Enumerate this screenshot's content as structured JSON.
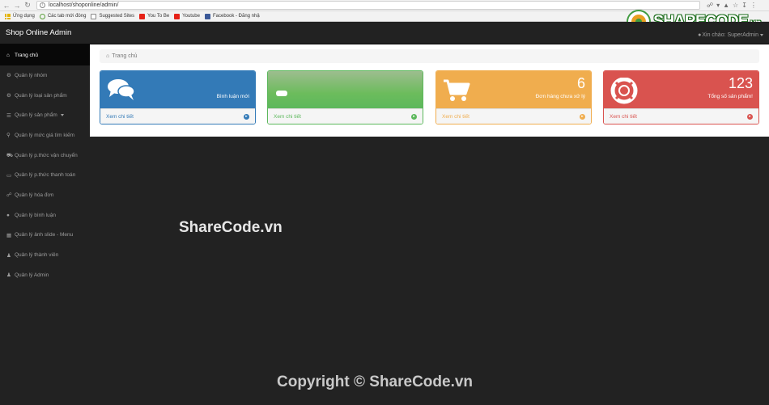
{
  "browser": {
    "url": "localhost/shoponline/admin/",
    "bookmarks": [
      {
        "label": "Ứng dụng",
        "icon": "apps-icon"
      },
      {
        "label": "Các tab mới đóng",
        "icon": "history-icon"
      },
      {
        "label": "Suggested Sites",
        "icon": "page-icon"
      },
      {
        "label": "You To Be",
        "icon": "youtube-icon"
      },
      {
        "label": "Youtube",
        "icon": "youtube-icon"
      },
      {
        "label": "Facebook - Đăng nhậ",
        "icon": "facebook-icon"
      }
    ]
  },
  "logo": {
    "text": "SHARECODE",
    "suffix": ".vn"
  },
  "navbar": {
    "brand": "Shop Online Admin",
    "user_greeting": "Xin chào: SuperAdmin"
  },
  "sidebar": {
    "items": [
      {
        "label": "Trang chủ",
        "icon": "home-icon",
        "active": true
      },
      {
        "label": "Quản lý nhóm",
        "icon": "gear-icon"
      },
      {
        "label": "Quản lý loại sản phẩm",
        "icon": "gears-icon"
      },
      {
        "label": "Quản lý sản phẩm",
        "icon": "list-icon",
        "has_caret": true
      },
      {
        "label": "Quản lý mức giá tìm kiếm",
        "icon": "search-icon"
      },
      {
        "label": "Quản lý p.thức vận chuyển",
        "icon": "truck-icon"
      },
      {
        "label": "Quản lý p.thức thanh toán",
        "icon": "credit-card-icon"
      },
      {
        "label": "Quản lý hóa đơn",
        "icon": "cart-icon"
      },
      {
        "label": "Quản lý bình luận",
        "icon": "comments-icon"
      },
      {
        "label": "Quản lý ảnh slide - Menu",
        "icon": "picture-icon"
      },
      {
        "label": "Quản lý thành viên",
        "icon": "user-icon"
      },
      {
        "label": "Quản lý Admin",
        "icon": "user-icon"
      }
    ]
  },
  "breadcrumb": {
    "label": "Trang chủ"
  },
  "panels": [
    {
      "count": "",
      "label": "Bình luận mới",
      "footer": "Xem chi tiết",
      "icon": "comments-icon",
      "color": "#337ab7"
    },
    {
      "count": "",
      "label": "",
      "footer": "Xem chi tiết",
      "icon": "tasks-icon",
      "color": "#5cb85c"
    },
    {
      "count": "6",
      "label": "Đơn hàng chưa xử lý",
      "footer": "Xem chi tiết",
      "icon": "shopping-cart-icon",
      "color": "#f0ad4e"
    },
    {
      "count": "123",
      "label": "Tổng số sản phẩm!",
      "footer": "Xem chi tiết",
      "icon": "support-icon",
      "color": "#d9534f"
    }
  ],
  "watermarks": {
    "center": "ShareCode.vn",
    "bottom": "Copyright © ShareCode.vn"
  }
}
